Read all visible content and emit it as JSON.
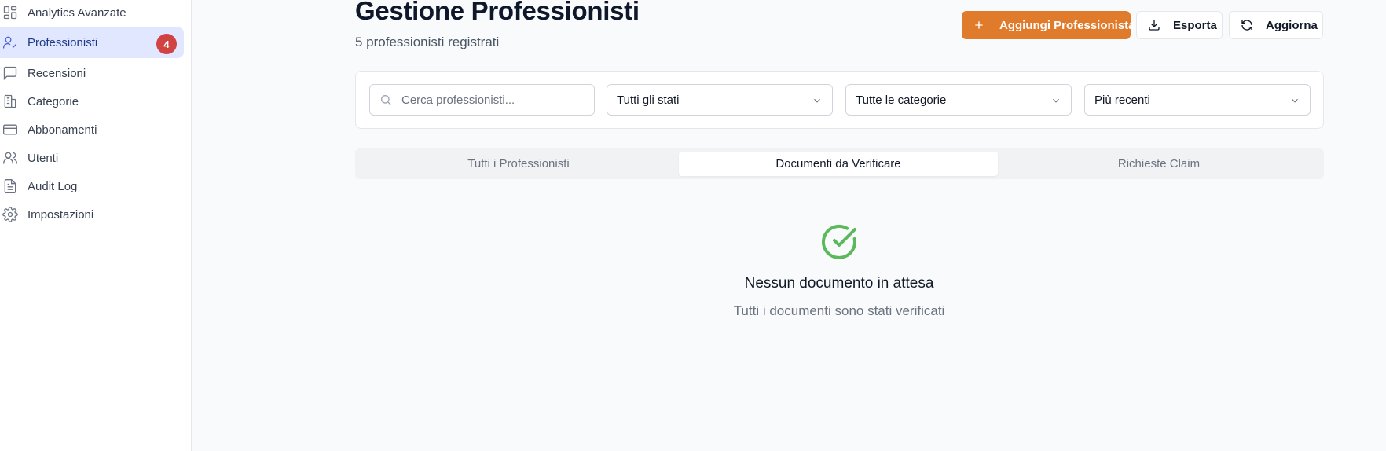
{
  "sidebar": {
    "items": [
      {
        "label": "Analytics Avanzate",
        "icon": "dashboard-grid-icon"
      },
      {
        "label": "Professionisti",
        "icon": "user-check-icon",
        "active": true,
        "badge": "4"
      },
      {
        "label": "Recensioni",
        "icon": "message-square-icon"
      },
      {
        "label": "Categorie",
        "icon": "building-icon"
      },
      {
        "label": "Abbonamenti",
        "icon": "credit-card-icon"
      },
      {
        "label": "Utenti",
        "icon": "users-icon"
      },
      {
        "label": "Audit Log",
        "icon": "file-text-icon"
      },
      {
        "label": "Impostazioni",
        "icon": "gear-icon"
      }
    ]
  },
  "header": {
    "title": "Gestione Professionisti",
    "subtitle": "5 professionisti registrati"
  },
  "actions": {
    "add_label": "Aggiungi Professionista",
    "export_label": "Esporta",
    "refresh_label": "Aggiorna"
  },
  "filters": {
    "search_placeholder": "Cerca professionisti...",
    "status_value": "Tutti gli stati",
    "category_value": "Tutte le categorie",
    "sort_value": "Più recenti"
  },
  "tabs": [
    {
      "label": "Tutti i Professionisti"
    },
    {
      "label": "Documenti da Verificare",
      "active": true
    },
    {
      "label": "Richieste Claim"
    }
  ],
  "empty_state": {
    "title": "Nessun documento in attesa",
    "subtitle": "Tutti i documenti sono stati verificati"
  },
  "colors": {
    "accent": "#e07b2c",
    "active_nav_bg": "#e0e7ff",
    "badge": "#d14343",
    "success": "#5cb85c"
  }
}
